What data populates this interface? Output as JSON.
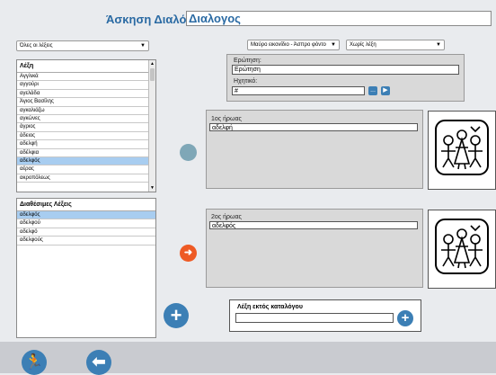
{
  "header": {
    "title_label": "Άσκηση Διαλόγου:",
    "title_value": "Διαλογος"
  },
  "filter": {
    "selected": "Όλες οι λέξεις"
  },
  "options": {
    "style_selected": "Μαύρο εικονίδιο - Άσπρο φόντο",
    "word_selected": "Χωρίς λέξη"
  },
  "words": {
    "header": "Λέξη",
    "items": [
      "Αγγλικά",
      "αγγούρι",
      "αγελάδα",
      "Άγιος Βασίλης",
      "αγκαλιάζω",
      "αγκώνες",
      "άγριος",
      "άδειος",
      "αδελφή",
      "αδέλφια",
      "αδελφός",
      "αέρας",
      "ακροπόλεως"
    ],
    "selected_index": 10
  },
  "available": {
    "header": "Διαθέσιμες Λέξεις",
    "items": [
      "αδελφός",
      "αδελφού",
      "αδελφό",
      "αδελφούς"
    ],
    "selected_index": 0
  },
  "question": {
    "label": "Ερώτηση:",
    "value": "Ερώτηση",
    "audio_label": "Ηχητικό:",
    "audio_value": "#",
    "browse_label": "..."
  },
  "hero1": {
    "label": "1ος ήρωας",
    "value": "αδελφή",
    "status_color": "#7fa7b7"
  },
  "hero2": {
    "label": "2ος ήρωας",
    "value": "αδελφός",
    "status_color": "#ee5a24"
  },
  "extra": {
    "label": "Λέξη εκτός καταλόγου",
    "value": ""
  },
  "colors": {
    "accent": "#2a6aa3",
    "button": "#3c7fb5"
  }
}
